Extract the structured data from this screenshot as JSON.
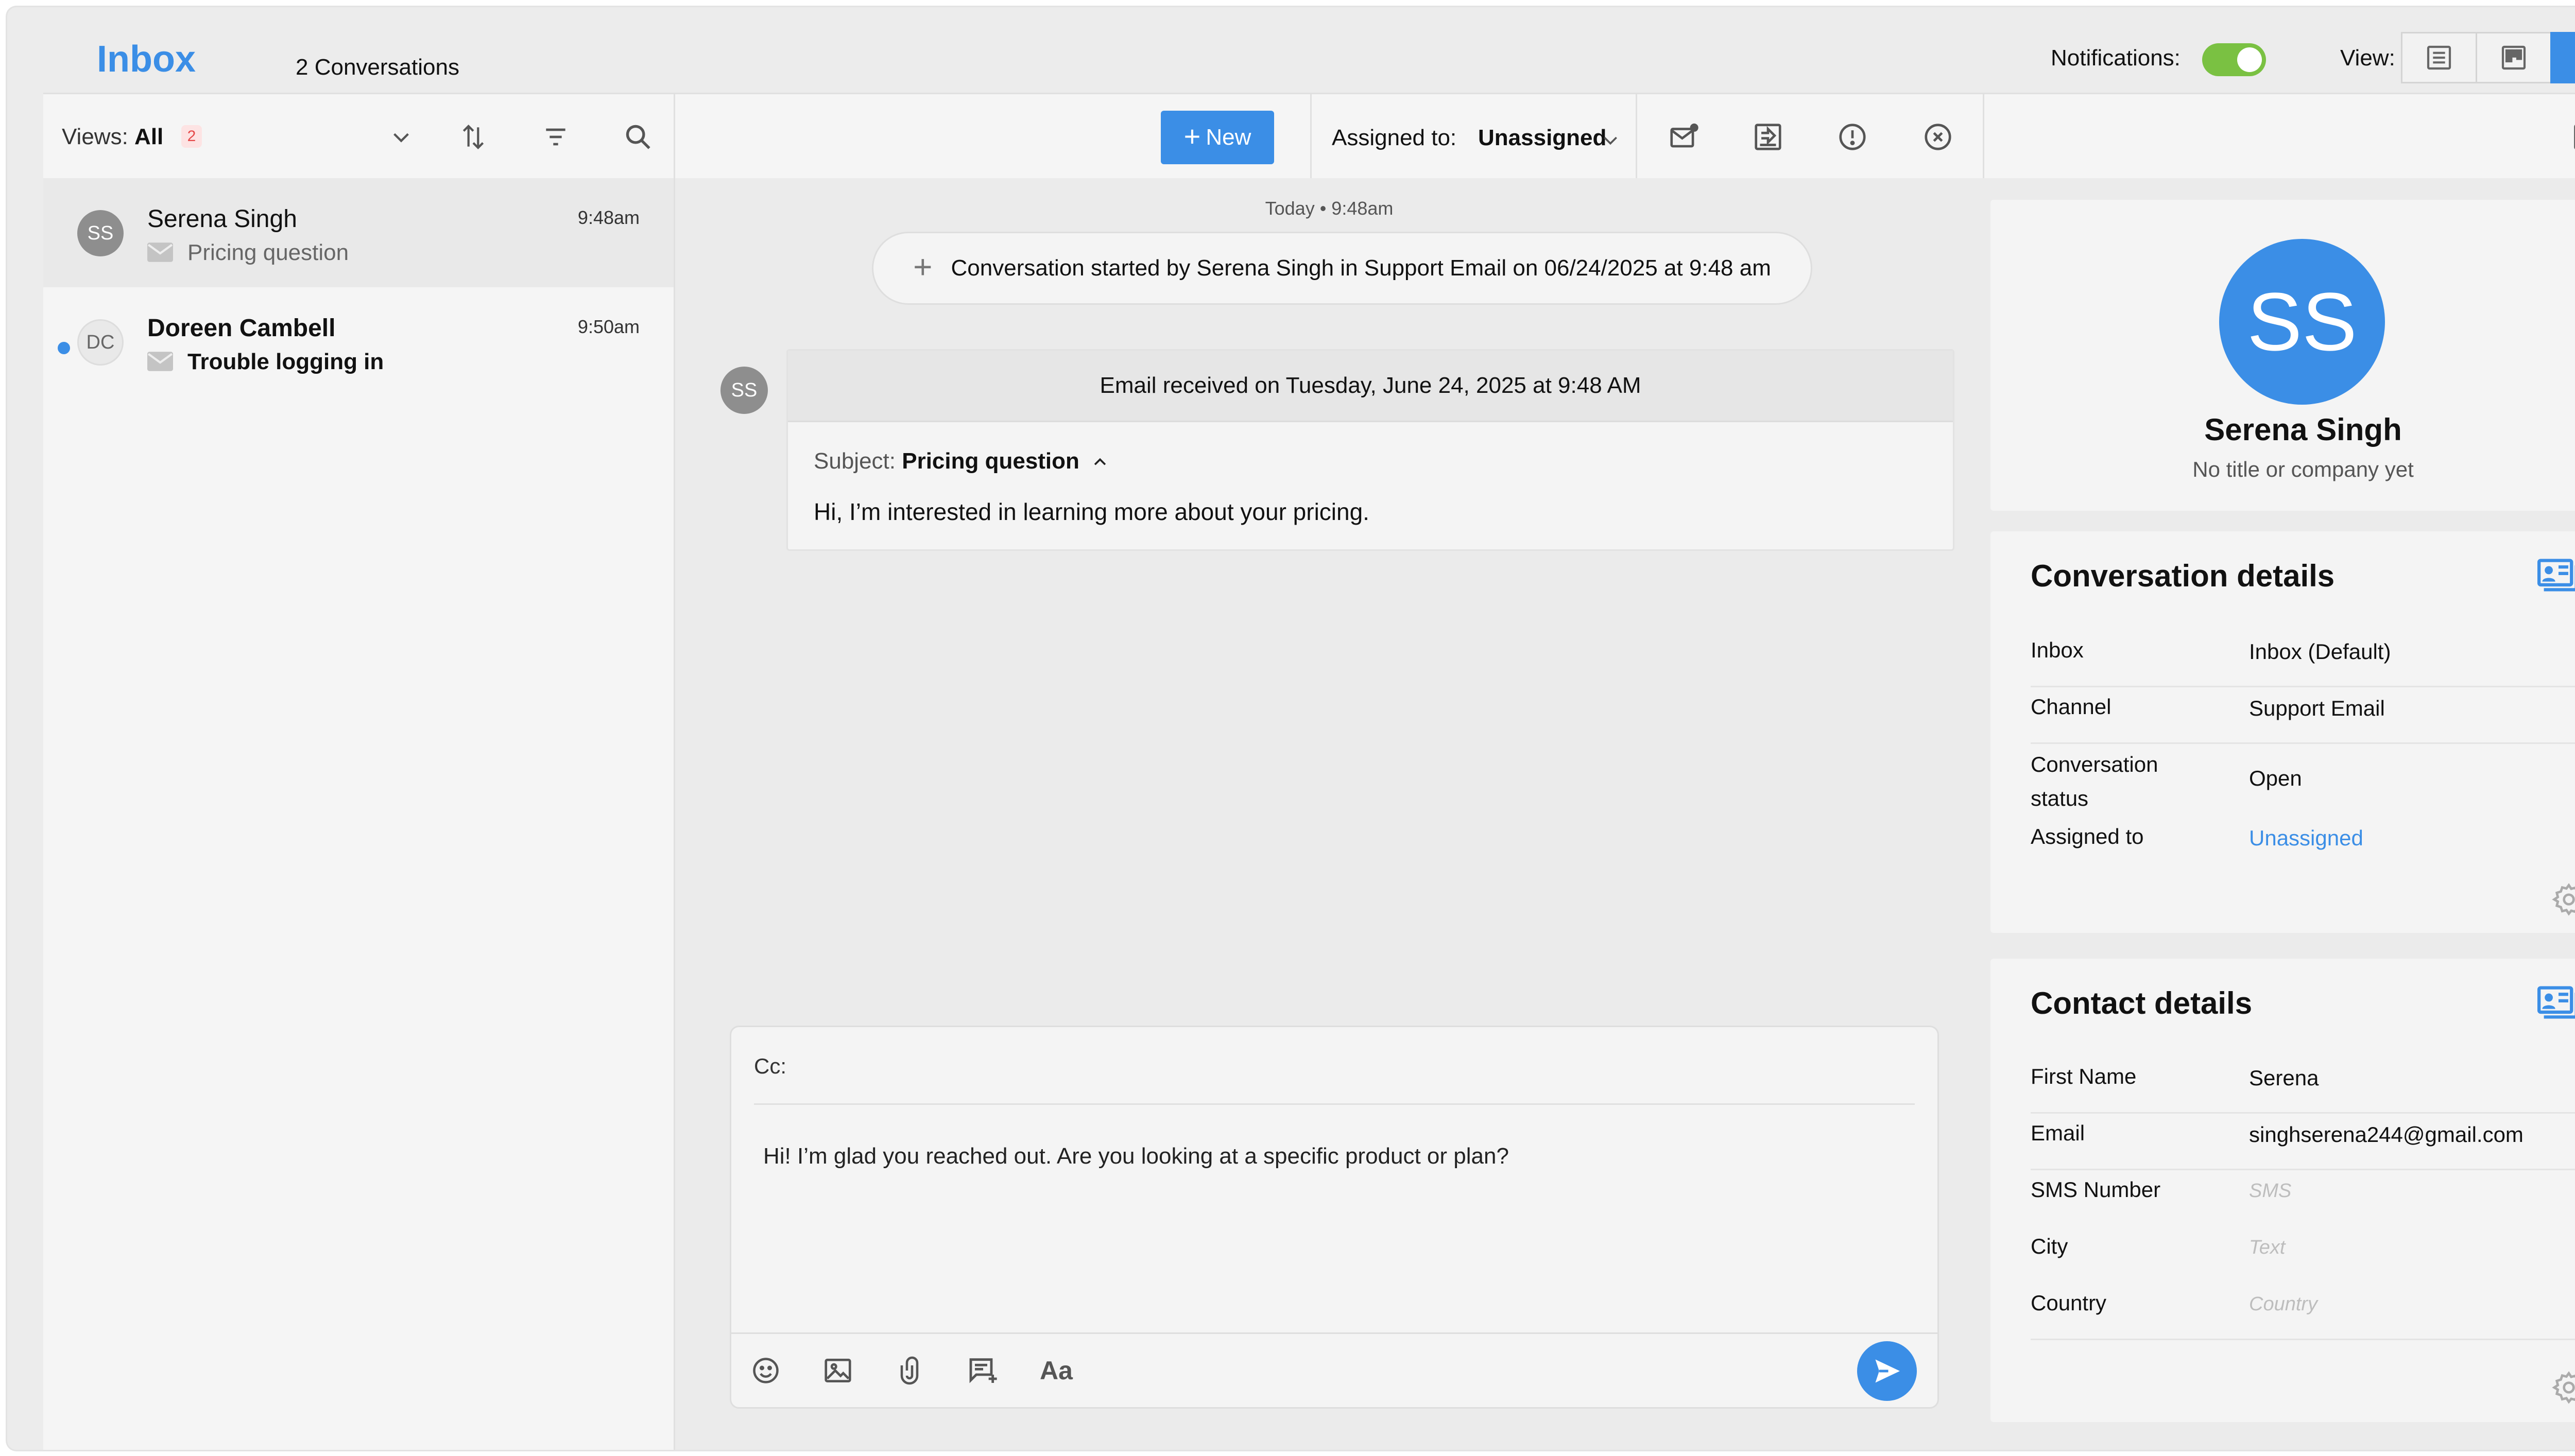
{
  "header": {
    "title": "Inbox",
    "conversation_count": "2 Conversations",
    "notifications_label": "Notifications:",
    "notifications_on": true,
    "view_label": "View:",
    "view_options": [
      "list-view-icon",
      "board-view-icon",
      "conversation-view-icon"
    ],
    "active_view": "conversation-view-icon"
  },
  "toolbar": {
    "views_label": "Views:",
    "views_value": "All",
    "views_badge": "2",
    "new_label": "New",
    "assigned_label": "Assigned to:",
    "assigned_value": "Unassigned"
  },
  "conversations": [
    {
      "initials": "SS",
      "name": "Serena Singh",
      "time": "9:48am",
      "subject": "Pricing question",
      "unread": false,
      "selected": true
    },
    {
      "initials": "DC",
      "name": "Doreen Cambell",
      "time": "9:50am",
      "subject": "Trouble logging in",
      "unread": true,
      "selected": false
    }
  ],
  "thread": {
    "date_marker": "Today • 9:48am",
    "started_text": "Conversation started by Serena Singh in Support Email on 06/24/2025 at 9:48 am",
    "sender_initials": "SS",
    "email_header": "Email received on Tuesday, June 24, 2025 at 9:48 AM",
    "subject_label": "Subject:",
    "subject_value": "Pricing question",
    "body": "Hi, I’m interested in learning more about your pricing."
  },
  "composer": {
    "cc_label": "Cc:",
    "text": "Hi! I’m glad you reached out. Are you looking at a specific product or plan?",
    "format_label": "Aa"
  },
  "profile": {
    "initials": "SS",
    "name": "Serena Singh",
    "subtitle": "No title or company yet"
  },
  "conversation_details": {
    "title": "Conversation details",
    "rows": [
      {
        "key": "Inbox",
        "value": "Inbox (Default)"
      },
      {
        "key": "Channel",
        "value": "Support Email"
      },
      {
        "key": "Conversation status",
        "value": "Open"
      },
      {
        "key": "Assigned to",
        "value": "Unassigned"
      }
    ]
  },
  "contact_details": {
    "title": "Contact details",
    "rows": [
      {
        "key": "First Name",
        "value": "Serena"
      },
      {
        "key": "Email",
        "value": "singhserena244@gmail.com"
      },
      {
        "key": "SMS Number",
        "value": "SMS"
      },
      {
        "key": "City",
        "value": "Text"
      },
      {
        "key": "Country",
        "value": "Country"
      }
    ]
  },
  "colors": {
    "accent": "#3b8ee6",
    "toggle_on": "#7ac142",
    "badge_text": "#e54848"
  }
}
